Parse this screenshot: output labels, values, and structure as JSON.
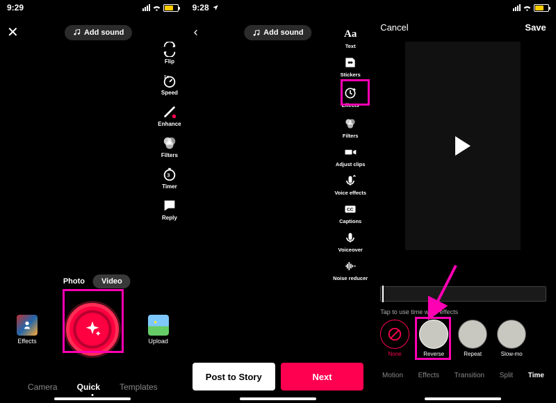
{
  "status": {
    "time_s1": "9:29",
    "time_s2": "9:28",
    "time_s3": ""
  },
  "s1": {
    "add_sound": "Add sound",
    "mode_photo": "Photo",
    "mode_video": "Video",
    "effects_label": "Effects",
    "upload_label": "Upload",
    "tools": {
      "flip": "Flip",
      "speed": "Speed",
      "enhance": "Enhance",
      "filters": "Filters",
      "timer": "Timer",
      "reply": "Reply"
    },
    "tabs": {
      "camera": "Camera",
      "quick": "Quick",
      "templates": "Templates"
    }
  },
  "s2": {
    "add_sound": "Add sound",
    "tools": {
      "text": "Text",
      "stickers": "Stickers",
      "effects": "Effects",
      "filters": "Filters",
      "adjust": "Adjust clips",
      "voice": "Voice effects",
      "captions": "Captions",
      "voiceover": "Voiceover",
      "noise": "Noise reducer"
    },
    "post_story": "Post to Story",
    "next": "Next"
  },
  "s3": {
    "cancel": "Cancel",
    "save": "Save",
    "hint": "Tap to use time warp effects",
    "effects": {
      "none": "None",
      "reverse": "Reverse",
      "repeat": "Repeat",
      "slowmo": "Slow-mo"
    },
    "cats": {
      "motion": "Motion",
      "effects": "Effects",
      "transition": "Transition",
      "split": "Split",
      "time": "Time"
    }
  },
  "colors": {
    "accent": "#ff0050",
    "highlight": "#ff00b3",
    "battery": "#ffcc00"
  }
}
